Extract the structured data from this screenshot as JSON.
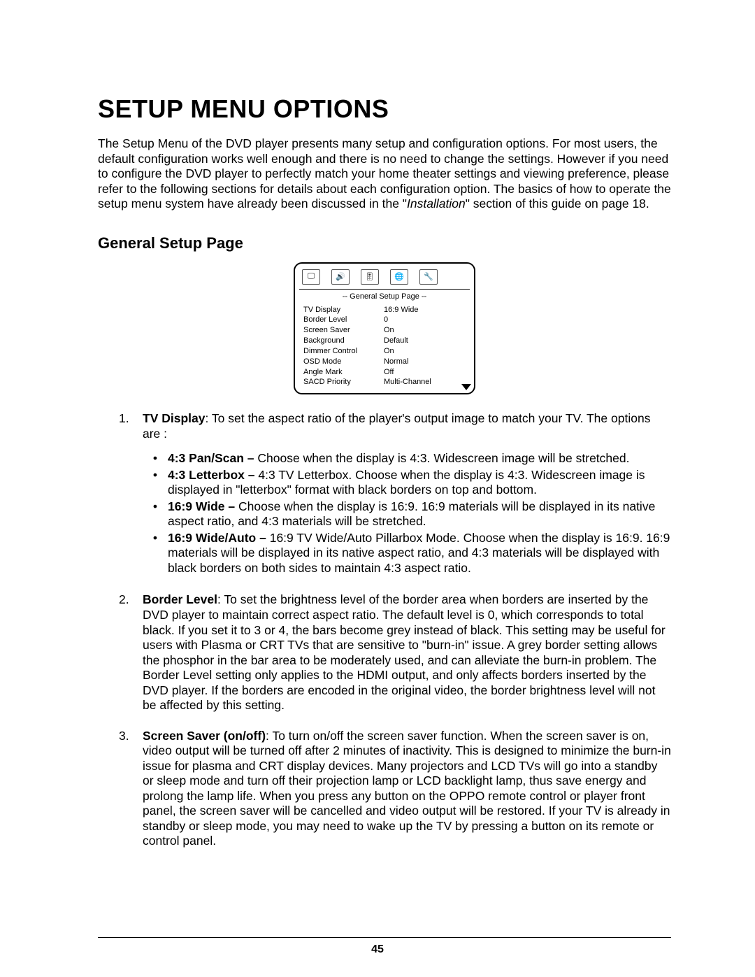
{
  "heading": "SETUP MENU OPTIONS",
  "intro": {
    "pre": "The Setup Menu of the DVD player presents many setup and configuration options.  For most users, the default configuration works well enough and there is no need to change the settings.  However if you need to configure the DVD player to perfectly match your home theater settings and viewing preference, please refer to the following sections for details about each configuration option.  The basics of how to operate the setup menu system have already been discussed in the \"",
    "italic": "Installation",
    "post": "\" section of this guide on page 18."
  },
  "subheading": "General Setup Page",
  "osd": {
    "title": "-- General Setup Page --",
    "icons": [
      "🖵",
      "🔊",
      "🎚",
      "🌐",
      "🔧"
    ],
    "rows": [
      {
        "label": "TV Display",
        "value": "16:9 Wide"
      },
      {
        "label": "Border Level",
        "value": "0"
      },
      {
        "label": "Screen Saver",
        "value": "On"
      },
      {
        "label": "Background",
        "value": "Default"
      },
      {
        "label": "Dimmer Control",
        "value": "On"
      },
      {
        "label": "OSD Mode",
        "value": "Normal"
      },
      {
        "label": "Angle Mark",
        "value": "Off"
      },
      {
        "label": "SACD Priority",
        "value": "Multi-Channel"
      }
    ]
  },
  "items": [
    {
      "num": "1.",
      "lead_bold": "TV Display",
      "lead_rest": ": To set the aspect ratio of the player's output image to match your TV.  The options are :",
      "subs": [
        {
          "bold": "4:3 Pan/Scan –",
          "rest": " Choose when the display is 4:3. Widescreen image will be stretched."
        },
        {
          "bold": "4:3 Letterbox –",
          "rest": " 4:3 TV Letterbox.  Choose when the display is 4:3.  Widescreen image is displayed in \"letterbox\" format with black borders on top and bottom."
        },
        {
          "bold": "16:9 Wide –",
          "rest": " Choose when the display is 16:9.  16:9 materials will be displayed in its native aspect ratio, and 4:3 materials will be stretched."
        },
        {
          "bold": "16:9 Wide/Auto –",
          "rest": " 16:9 TV Wide/Auto Pillarbox Mode.  Choose when the display is 16:9.  16:9 materials will be displayed in its native aspect ratio, and 4:3 materials will be displayed with black borders on both sides to maintain 4:3 aspect ratio."
        }
      ]
    },
    {
      "num": "2.",
      "lead_bold": "Border Level",
      "lead_rest": ": To set the brightness level of the border area when borders are inserted by the DVD player to maintain correct aspect ratio.  The default level is 0, which corresponds to total black.  If you set it to 3 or 4, the bars become grey instead of black.  This setting may be useful for users with Plasma or CRT TVs that are sensitive to \"burn-in\" issue.  A grey border setting allows the phosphor in the bar area to be moderately used, and can alleviate the burn-in problem.  The Border Level setting only applies to the HDMI output, and only affects borders inserted by the DVD player.  If the borders are encoded in the original video, the border brightness level will not be affected by this setting."
    },
    {
      "num": "3.",
      "lead_bold": "Screen Saver (on/off)",
      "lead_rest": ": To turn on/off the screen saver function.  When the screen saver is on, video output will be turned off after 2 minutes of inactivity.  This is designed to minimize the burn-in issue for plasma and CRT display devices.  Many projectors and LCD TVs will go into a standby or sleep mode and turn off their projection lamp or LCD backlight lamp, thus save energy and prolong the lamp life.  When you press any button on the OPPO remote control or player front panel, the screen saver will be cancelled and video output will be restored.  If your TV is already in standby or sleep mode, you may need to wake up the TV by pressing a button on its remote or control panel."
    }
  ],
  "page_number": "45",
  "bullet": "•"
}
